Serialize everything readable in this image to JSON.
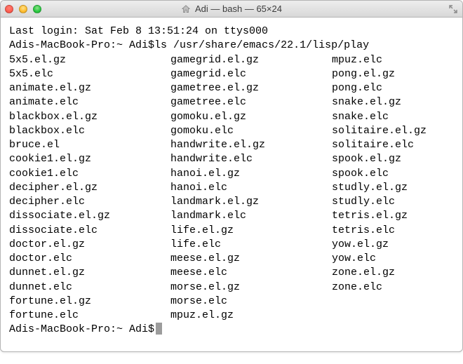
{
  "titlebar": {
    "title": "Adi — bash — 65×24"
  },
  "login_line": "Last login: Sat Feb  8 13:51:24 on ttys000",
  "prompt": "Adis-MacBook-Pro:~ Adi$ ",
  "command": "ls /usr/share/emacs/22.1/lisp/play",
  "columns": {
    "c1": [
      "5x5.el.gz",
      "5x5.elc",
      "animate.el.gz",
      "animate.elc",
      "blackbox.el.gz",
      "blackbox.elc",
      "bruce.el",
      "cookie1.el.gz",
      "cookie1.elc",
      "decipher.el.gz",
      "decipher.elc",
      "dissociate.el.gz",
      "dissociate.elc",
      "doctor.el.gz",
      "doctor.elc",
      "dunnet.el.gz",
      "dunnet.elc",
      "fortune.el.gz",
      "fortune.elc"
    ],
    "c2": [
      "gamegrid.el.gz",
      "gamegrid.elc",
      "gametree.el.gz",
      "gametree.elc",
      "gomoku.el.gz",
      "gomoku.elc",
      "handwrite.el.gz",
      "handwrite.elc",
      "hanoi.el.gz",
      "hanoi.elc",
      "landmark.el.gz",
      "landmark.elc",
      "life.el.gz",
      "life.elc",
      "meese.el.gz",
      "meese.elc",
      "morse.el.gz",
      "morse.elc",
      "mpuz.el.gz"
    ],
    "c3": [
      "mpuz.elc",
      "pong.el.gz",
      "pong.elc",
      "snake.el.gz",
      "snake.elc",
      "solitaire.el.gz",
      "solitaire.elc",
      "spook.el.gz",
      "spook.elc",
      "studly.el.gz",
      "studly.elc",
      "tetris.el.gz",
      "tetris.elc",
      "yow.el.gz",
      "yow.elc",
      "zone.el.gz",
      "zone.elc"
    ]
  }
}
